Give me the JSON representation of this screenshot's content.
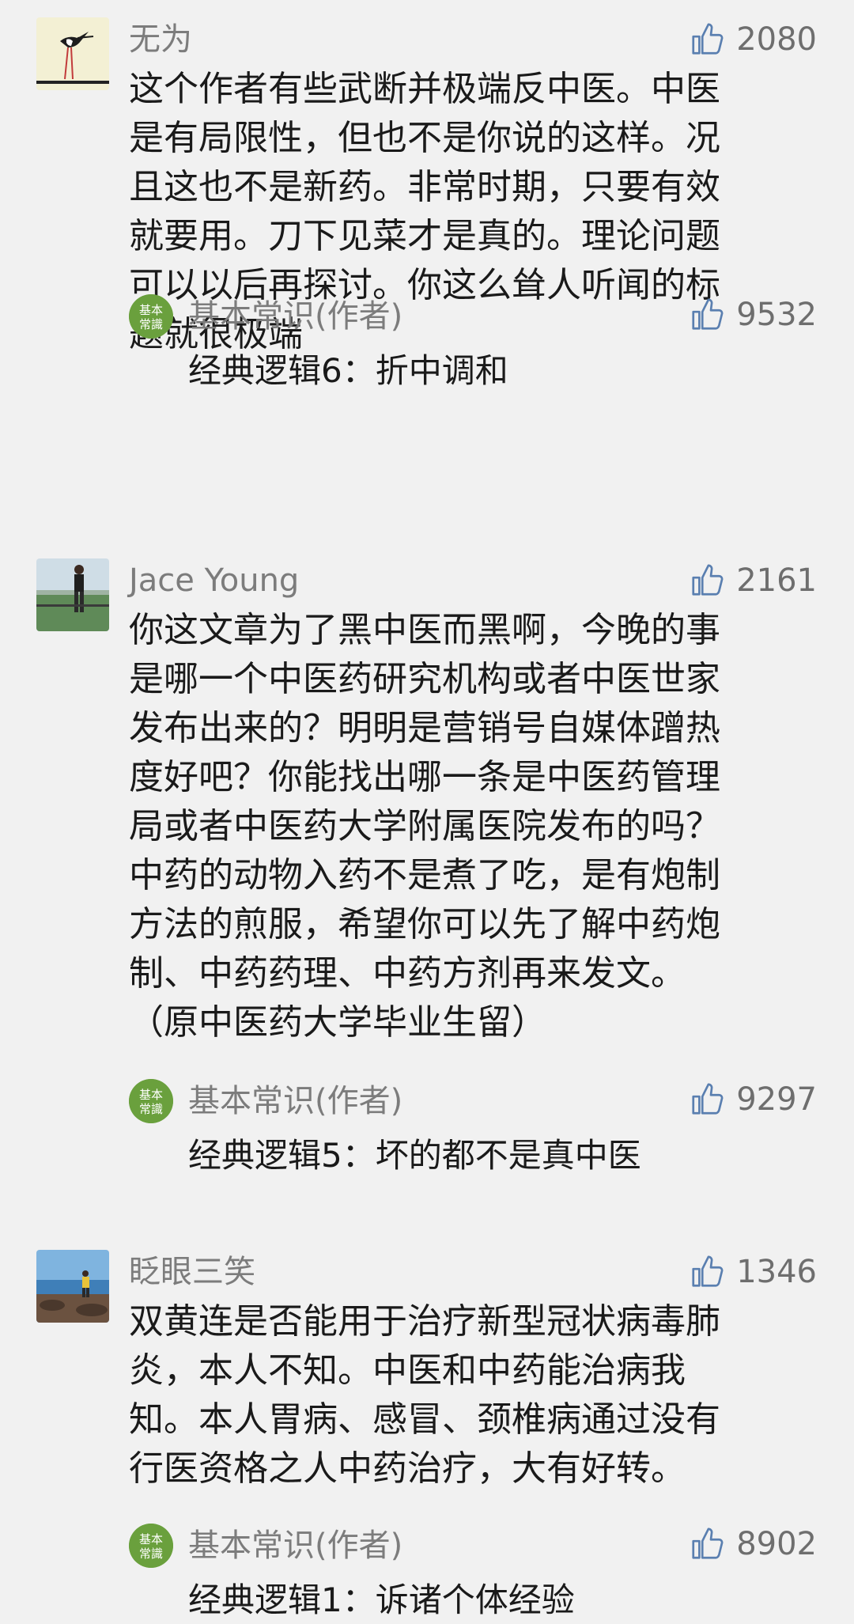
{
  "comments": [
    {
      "user": "无为",
      "likes": "2080",
      "text": "这个作者有些武断并极端反中医。中医\n是有局限性，但也不是你说的这样。况\n且这也不是新药。非常时期，只要有效\n就要用。刀下见菜才是真的。理论问题\n可以以后再探讨。你这么耸人听闻的标\n题就很极端",
      "reply": {
        "author": "基本常识(作者)",
        "likes": "9532",
        "text": "经典逻辑6：折中调和"
      }
    },
    {
      "user": "Jace Young",
      "likes": "2161",
      "text": "你这文章为了黑中医而黑啊，今晚的事\n是哪一个中医药研究机构或者中医世家\n发布出来的？明明是营销号自媒体蹭热\n度好吧？你能找出哪一条是中医药管理\n局或者中医药大学附属医院发布的吗？\n中药的动物入药不是煮了吃，是有炮制\n方法的煎服，希望你可以先了解中药炮\n制、中药药理、中药方剂再来发文。\n（原中医药大学毕业生留）",
      "reply": {
        "author": "基本常识(作者)",
        "likes": "9297",
        "text": "经典逻辑5：坏的都不是真中医"
      }
    },
    {
      "user": "眨眼三笑",
      "likes": "1346",
      "text": "双黄连是否能用于治疗新型冠状病毒肺\n炎，本人不知。中医和中药能治病我\n知。本人胃病、感冒、颈椎病通过没有\n行医资格之人中药治疗，大有好转。",
      "reply": {
        "author": "基本常识(作者)",
        "likes": "8902",
        "text": "经典逻辑1：诉诸个体经验"
      }
    }
  ],
  "icons": {
    "like": "thumbs-up-icon",
    "author_avatar_text": "基本常識"
  },
  "colors": {
    "background": "#f1f1f1",
    "name": "#7c7c7c",
    "body": "#1a1a1a",
    "author_avatar": "#6aa03d"
  }
}
